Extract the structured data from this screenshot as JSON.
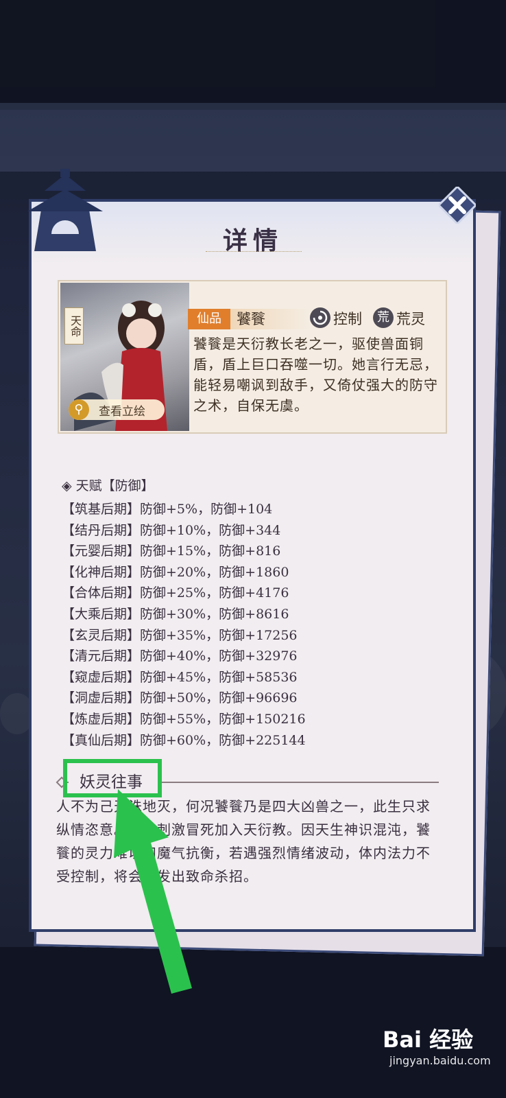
{
  "panel": {
    "title": "详情"
  },
  "character": {
    "fate_badge": "天命",
    "view_button_label": "查看立绘",
    "quality_tag": "仙品",
    "name": "饕餮",
    "type1_icon_char": "",
    "type1_label": "控制",
    "type2_icon_char": "荒",
    "type2_label": "荒灵",
    "description": "饕餮是天衍教长老之一，驱使兽面铜盾，盾上巨口吞噬一切。她言行无忌，能轻易嘲讽到敌手，又倚仗强大的防守之术，自保无虞。"
  },
  "talent": {
    "title": "天赋【防御】",
    "rows": [
      "【筑基后期】防御+5%，防御+104",
      "【结丹后期】防御+10%，防御+344",
      "【元婴后期】防御+15%，防御+816",
      "【化神后期】防御+20%，防御+1860",
      "【合体后期】防御+25%，防御+4176",
      "【大乘后期】防御+30%，防御+8616",
      "【玄灵后期】防御+35%，防御+17256",
      "【清元后期】防御+40%，防御+32976",
      "【窥虚后期】防御+45%，防御+58536",
      "【洞虚后期】防御+50%，防御+96696",
      "【炼虚后期】防御+55%，防御+150216",
      "【真仙后期】防御+60%，防御+225144"
    ]
  },
  "lore": {
    "title": "妖灵往事",
    "text": "人不为己天诛地灭，何况饕餮乃是四大凶兽之一，此生只求纵情恣意。为求刺激冒死加入天衍教。因天生神识混沌，饕餮的灵力难以和魔气抗衡，若遇强烈情绪波动，体内法力不受控制，将会爆发出致命杀招。"
  },
  "watermark": {
    "main": "Bai 经验",
    "sub": "jingyan.baidu.com"
  },
  "colors": {
    "highlight": "#2bc14d",
    "panel_border": "#2f3d68",
    "quality_tag": "#e07e2c"
  }
}
